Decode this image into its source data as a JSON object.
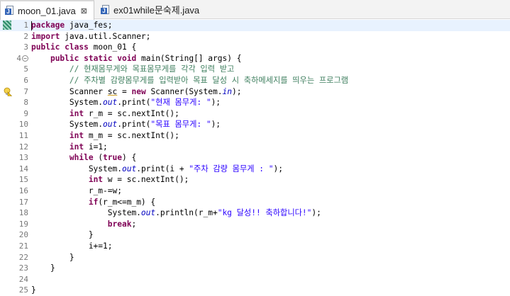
{
  "tabs": [
    {
      "label": "moon_01.java",
      "close": "⊠"
    },
    {
      "label": "ex01while문숙제.java"
    }
  ],
  "lines": [
    {
      "n": "1",
      "tokens": [
        [
          "kw",
          "package"
        ],
        [
          "",
          " java_fes;"
        ]
      ]
    },
    {
      "n": "2",
      "tokens": [
        [
          "kw",
          "import"
        ],
        [
          "",
          " java.util.Scanner;"
        ]
      ]
    },
    {
      "n": "3",
      "tokens": [
        [
          "kw",
          "public"
        ],
        [
          "",
          " "
        ],
        [
          "kw",
          "class"
        ],
        [
          "",
          " moon_01 {"
        ]
      ]
    },
    {
      "n": "4",
      "tokens": [
        [
          "",
          "    "
        ],
        [
          "kw",
          "public"
        ],
        [
          "",
          " "
        ],
        [
          "kw",
          "static"
        ],
        [
          "",
          " "
        ],
        [
          "kw",
          "void"
        ],
        [
          "",
          " main(String[] args) {"
        ]
      ]
    },
    {
      "n": "5",
      "tokens": [
        [
          "",
          "        "
        ],
        [
          "cm",
          "// 현재몸무게와 목표몸무게를 각각 입력 받고"
        ]
      ]
    },
    {
      "n": "6",
      "tokens": [
        [
          "",
          "        "
        ],
        [
          "cm",
          "// 주차별 감량몸무게를 입력받아 목표 달성 시 축하메세지를 띄우는 프로그램"
        ]
      ]
    },
    {
      "n": "7",
      "tokens": [
        [
          "",
          "        Scanner "
        ],
        [
          "uline",
          "sc"
        ],
        [
          "",
          " = "
        ],
        [
          "kw",
          "new"
        ],
        [
          "",
          " Scanner(System."
        ],
        [
          "fld",
          "in"
        ],
        [
          "",
          ");"
        ]
      ]
    },
    {
      "n": "8",
      "tokens": [
        [
          "",
          "        System."
        ],
        [
          "fld",
          "out"
        ],
        [
          "",
          ".print("
        ],
        [
          "st",
          "\"현재 몸무게: \""
        ],
        [
          "",
          ");"
        ]
      ]
    },
    {
      "n": "9",
      "tokens": [
        [
          "",
          "        "
        ],
        [
          "kw",
          "int"
        ],
        [
          "",
          " r_m = sc.nextInt();"
        ]
      ]
    },
    {
      "n": "10",
      "tokens": [
        [
          "",
          "        System."
        ],
        [
          "fld",
          "out"
        ],
        [
          "",
          ".print("
        ],
        [
          "st",
          "\"목표 몸무게: \""
        ],
        [
          "",
          ");"
        ]
      ]
    },
    {
      "n": "11",
      "tokens": [
        [
          "",
          "        "
        ],
        [
          "kw",
          "int"
        ],
        [
          "",
          " m_m = sc.nextInt();"
        ]
      ]
    },
    {
      "n": "12",
      "tokens": [
        [
          "",
          "        "
        ],
        [
          "kw",
          "int"
        ],
        [
          "",
          " i=1;"
        ]
      ]
    },
    {
      "n": "13",
      "tokens": [
        [
          "",
          "        "
        ],
        [
          "kw",
          "while"
        ],
        [
          "",
          " ("
        ],
        [
          "kw",
          "true"
        ],
        [
          "",
          ") {"
        ]
      ]
    },
    {
      "n": "14",
      "tokens": [
        [
          "",
          "            System."
        ],
        [
          "fld",
          "out"
        ],
        [
          "",
          ".print(i + "
        ],
        [
          "st",
          "\"주차 감량 몸무게 : \""
        ],
        [
          "",
          ");"
        ]
      ]
    },
    {
      "n": "15",
      "tokens": [
        [
          "",
          "            "
        ],
        [
          "kw",
          "int"
        ],
        [
          "",
          " w = sc.nextInt();"
        ]
      ]
    },
    {
      "n": "16",
      "tokens": [
        [
          "",
          "            r_m-=w;"
        ]
      ]
    },
    {
      "n": "17",
      "tokens": [
        [
          "",
          "            "
        ],
        [
          "kw",
          "if"
        ],
        [
          "",
          "(r_m<=m_m) {"
        ]
      ]
    },
    {
      "n": "18",
      "tokens": [
        [
          "",
          "                System."
        ],
        [
          "fld",
          "out"
        ],
        [
          "",
          ".println(r_m+"
        ],
        [
          "st",
          "\"kg 달성!! 축하합니다!\""
        ],
        [
          "",
          ");"
        ]
      ]
    },
    {
      "n": "19",
      "tokens": [
        [
          "",
          "                "
        ],
        [
          "kw",
          "break"
        ],
        [
          "",
          ";"
        ]
      ]
    },
    {
      "n": "20",
      "tokens": [
        [
          "",
          "            }"
        ]
      ]
    },
    {
      "n": "21",
      "tokens": [
        [
          "",
          "            i+=1;"
        ]
      ]
    },
    {
      "n": "22",
      "tokens": [
        [
          "",
          "        }"
        ]
      ]
    },
    {
      "n": "23",
      "tokens": [
        [
          "",
          "    }"
        ]
      ]
    },
    {
      "n": "24",
      "tokens": []
    },
    {
      "n": "25",
      "tokens": [
        [
          "",
          "}"
        ]
      ]
    }
  ],
  "colors": {
    "keyword": "#7f0055",
    "comment": "#3f7f5f",
    "string": "#2a00ff",
    "field": "#0000c0",
    "current_line": "#e8f2fe"
  }
}
